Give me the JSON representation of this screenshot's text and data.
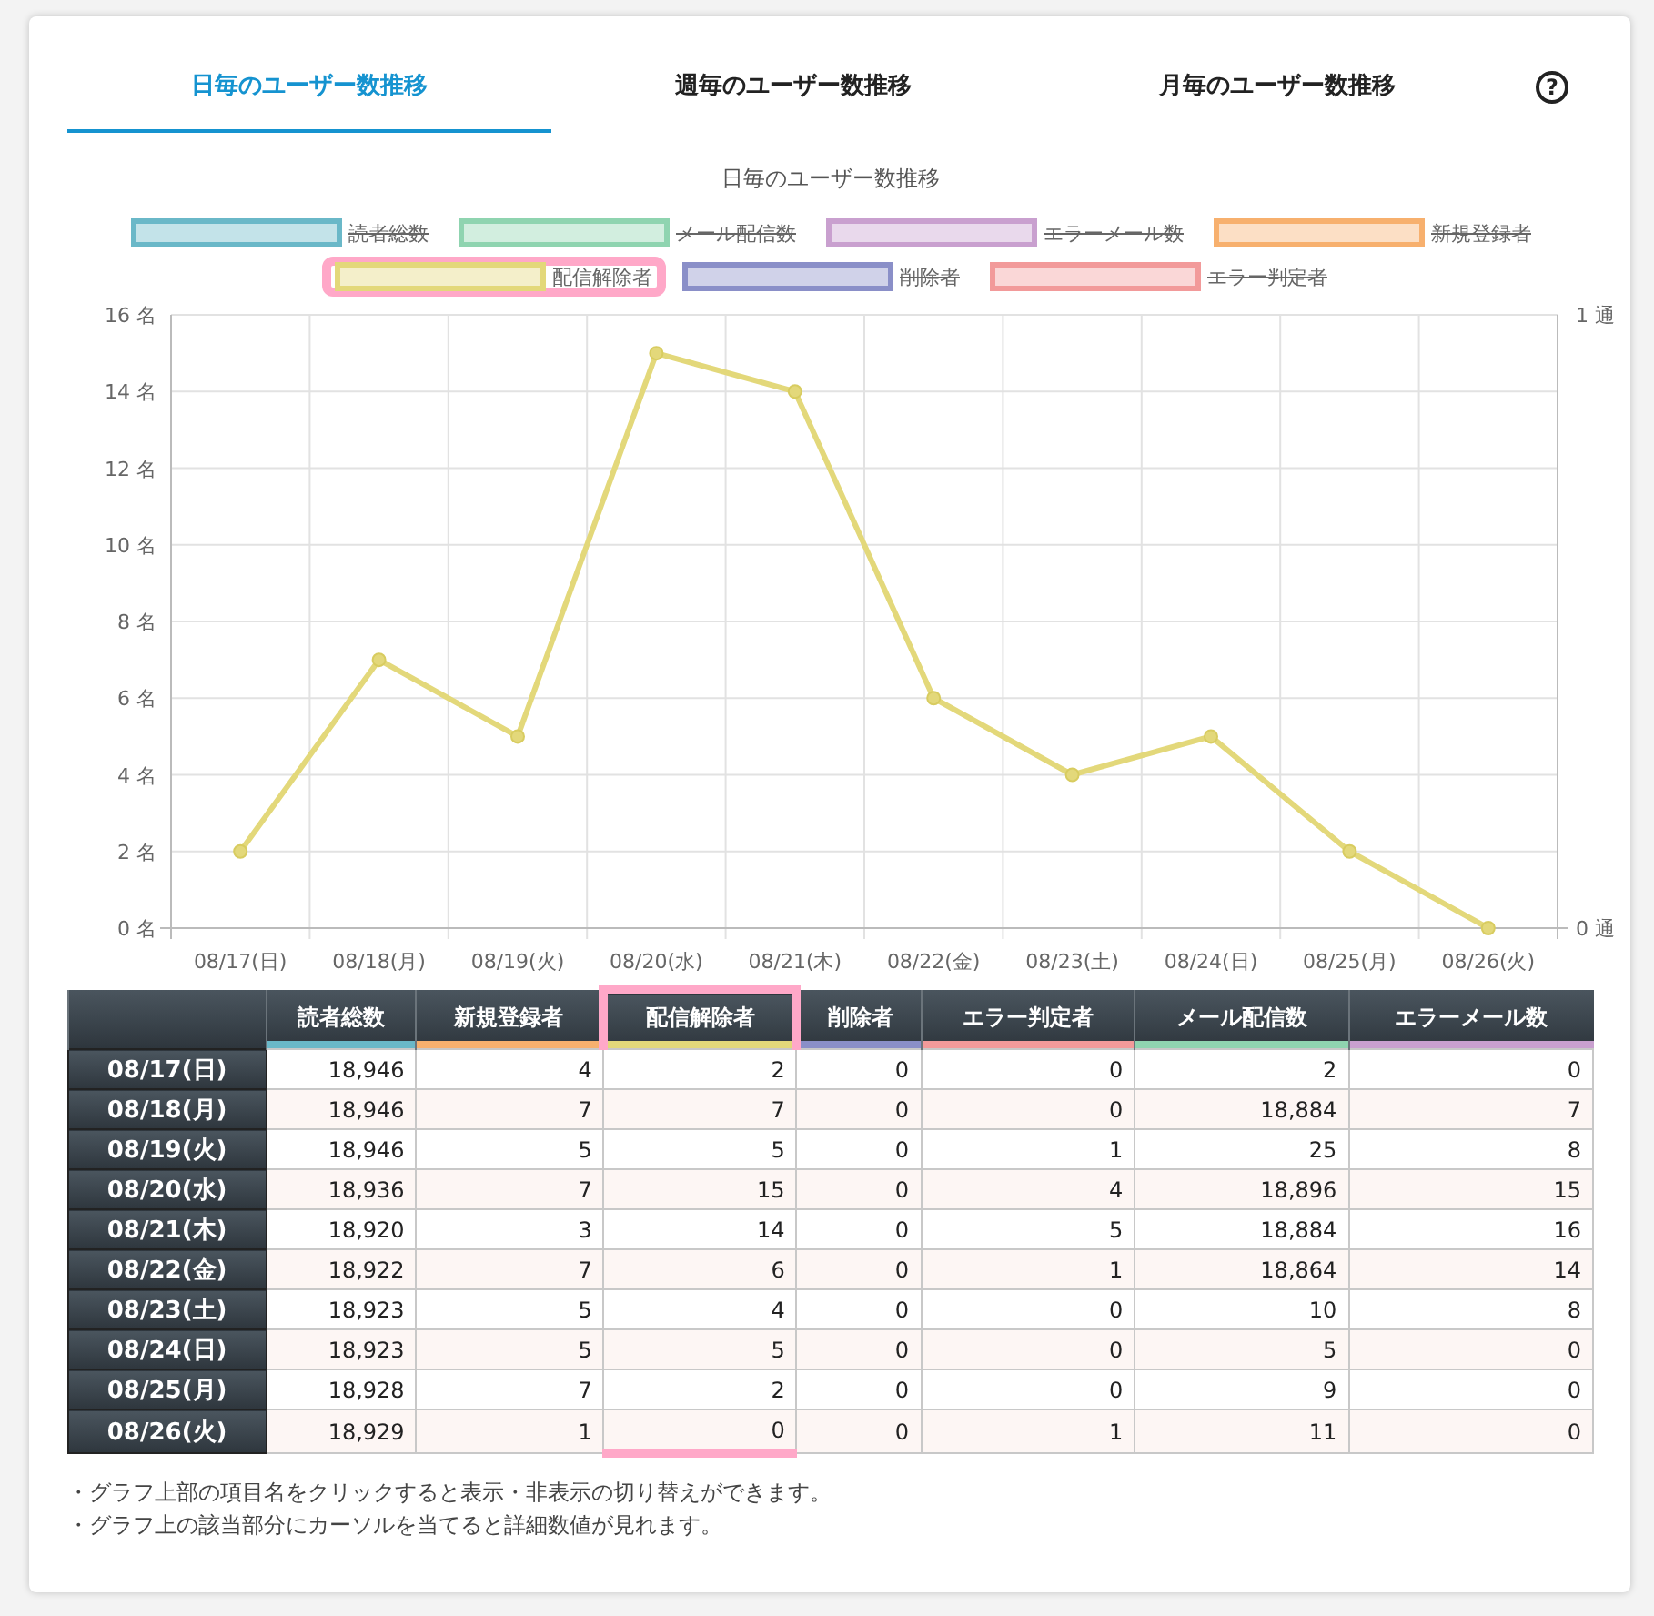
{
  "tabs": [
    {
      "label": "日毎のユーザー数推移",
      "selected": true
    },
    {
      "label": "週毎のユーザー数推移",
      "selected": false
    },
    {
      "label": "月毎のユーザー数推移",
      "selected": false
    }
  ],
  "help_button": {
    "label": "?"
  },
  "chart": {
    "title": "日毎のユーザー数推移",
    "legend": [
      {
        "label": "読者総数",
        "color": "#6ab8c8",
        "hidden": true,
        "highlighted": false
      },
      {
        "label": "メール配信数",
        "color": "#8fd4b0",
        "hidden": true,
        "highlighted": false
      },
      {
        "label": "エラーメール数",
        "color": "#c9a0cf",
        "hidden": true,
        "highlighted": false
      },
      {
        "label": "新規登録者",
        "color": "#f7b06e",
        "hidden": true,
        "highlighted": false
      },
      {
        "label": "配信解除者",
        "color": "#e3d87a",
        "hidden": false,
        "highlighted": true
      },
      {
        "label": "削除者",
        "color": "#8a8fc8",
        "hidden": true,
        "highlighted": false
      },
      {
        "label": "エラー判定者",
        "color": "#f29a9a",
        "hidden": true,
        "highlighted": false
      }
    ],
    "chart_data": {
      "type": "line",
      "categories": [
        "08/17(日)",
        "08/18(月)",
        "08/19(火)",
        "08/20(水)",
        "08/21(木)",
        "08/22(金)",
        "08/23(土)",
        "08/24(日)",
        "08/25(月)",
        "08/26(火)"
      ],
      "series": [
        {
          "color": "#e3d87a",
          "marker": "circle",
          "values": [
            2,
            7,
            5,
            15,
            14,
            6,
            4,
            5,
            2,
            0
          ]
        }
      ],
      "grid": true,
      "y2lim": [
        0,
        1
      ],
      "ylim": [
        0,
        16
      ],
      "yticks": [
        {
          "value": 0,
          "label": "0 名"
        },
        {
          "value": 2,
          "label": "2 名"
        },
        {
          "value": 4,
          "label": "4 名"
        },
        {
          "value": 6,
          "label": "6 名"
        },
        {
          "value": 8,
          "label": "8 名"
        },
        {
          "value": 10,
          "label": "10 名"
        },
        {
          "value": 12,
          "label": "12 名"
        },
        {
          "value": 14,
          "label": "14 名"
        },
        {
          "value": 16,
          "label": "16 名"
        }
      ],
      "y2ticks": [
        {
          "value": 0,
          "label": "0 通"
        },
        {
          "value": 1,
          "label": "1 通"
        }
      ]
    }
  },
  "table": {
    "columns": [
      {
        "label": "読者総数",
        "color": "#6ab8c8",
        "highlighted": false
      },
      {
        "label": "新規登録者",
        "color": "#f7b06e",
        "highlighted": false
      },
      {
        "label": "配信解除者",
        "color": "#e3d87a",
        "highlighted": true
      },
      {
        "label": "削除者",
        "color": "#8a8fc8",
        "highlighted": false
      },
      {
        "label": "エラー判定者",
        "color": "#f29a9a",
        "highlighted": false
      },
      {
        "label": "メール配信数",
        "color": "#8fd4b0",
        "highlighted": false
      },
      {
        "label": "エラーメール数",
        "color": "#c9a0cf",
        "highlighted": false
      }
    ],
    "rows": [
      {
        "date": "08/17(日)",
        "cells": [
          "18,946",
          "4",
          "2",
          "0",
          "0",
          "2",
          "0"
        ]
      },
      {
        "date": "08/18(月)",
        "cells": [
          "18,946",
          "7",
          "7",
          "0",
          "0",
          "18,884",
          "7"
        ]
      },
      {
        "date": "08/19(火)",
        "cells": [
          "18,946",
          "5",
          "5",
          "0",
          "1",
          "25",
          "8"
        ]
      },
      {
        "date": "08/20(水)",
        "cells": [
          "18,936",
          "7",
          "15",
          "0",
          "4",
          "18,896",
          "15"
        ]
      },
      {
        "date": "08/21(木)",
        "cells": [
          "18,920",
          "3",
          "14",
          "0",
          "5",
          "18,884",
          "16"
        ]
      },
      {
        "date": "08/22(金)",
        "cells": [
          "18,922",
          "7",
          "6",
          "0",
          "1",
          "18,864",
          "14"
        ]
      },
      {
        "date": "08/23(土)",
        "cells": [
          "18,923",
          "5",
          "4",
          "0",
          "0",
          "10",
          "8"
        ]
      },
      {
        "date": "08/24(日)",
        "cells": [
          "18,923",
          "5",
          "5",
          "0",
          "0",
          "5",
          "0"
        ]
      },
      {
        "date": "08/25(月)",
        "cells": [
          "18,928",
          "7",
          "2",
          "0",
          "0",
          "9",
          "0"
        ]
      },
      {
        "date": "08/26(火)",
        "cells": [
          "18,929",
          "1",
          "0",
          "0",
          "1",
          "11",
          "0"
        ]
      }
    ]
  },
  "notes": [
    "・グラフ上部の項目名をクリックすると表示・非表示の切り替えができます。",
    "・グラフ上の該当部分にカーソルを当てると詳細数値が見れます。"
  ]
}
